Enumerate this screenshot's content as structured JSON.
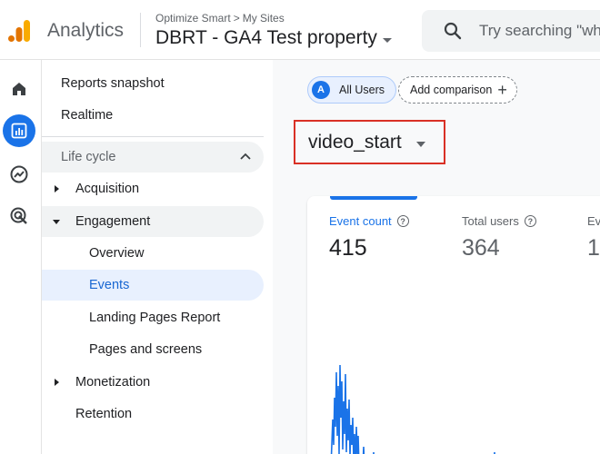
{
  "header": {
    "app_name": "Analytics",
    "breadcrumb_account": "Optimize Smart",
    "breadcrumb_sep": ">",
    "breadcrumb_site": "My Sites",
    "property_name": "DBRT - GA4 Test property",
    "search_placeholder": "Try searching \"wh"
  },
  "colors": {
    "accent": "#1a73e8",
    "highlight_border": "#d93025",
    "logo_orange": "#f9ab00",
    "logo_dark": "#e37400"
  },
  "rail": {
    "items": [
      {
        "icon": "home-icon"
      },
      {
        "icon": "reports-icon",
        "active": true
      },
      {
        "icon": "explore-icon"
      },
      {
        "icon": "advertising-icon"
      }
    ]
  },
  "nav": {
    "reports_snapshot": "Reports snapshot",
    "realtime": "Realtime",
    "section_lifecycle": "Life cycle",
    "acquisition": "Acquisition",
    "engagement": "Engagement",
    "overview": "Overview",
    "events": "Events",
    "landing_pages": "Landing Pages Report",
    "pages_screens": "Pages and screens",
    "monetization": "Monetization",
    "retention": "Retention"
  },
  "main": {
    "all_users_avatar": "A",
    "all_users": "All Users",
    "add_comparison": "Add comparison",
    "add_comparison_plus": "+",
    "event_name": "video_start",
    "metrics": [
      {
        "label": "Event count",
        "value": "415"
      },
      {
        "label": "Total users",
        "value": "364"
      },
      {
        "label": "Ev",
        "value": "1."
      }
    ]
  }
}
